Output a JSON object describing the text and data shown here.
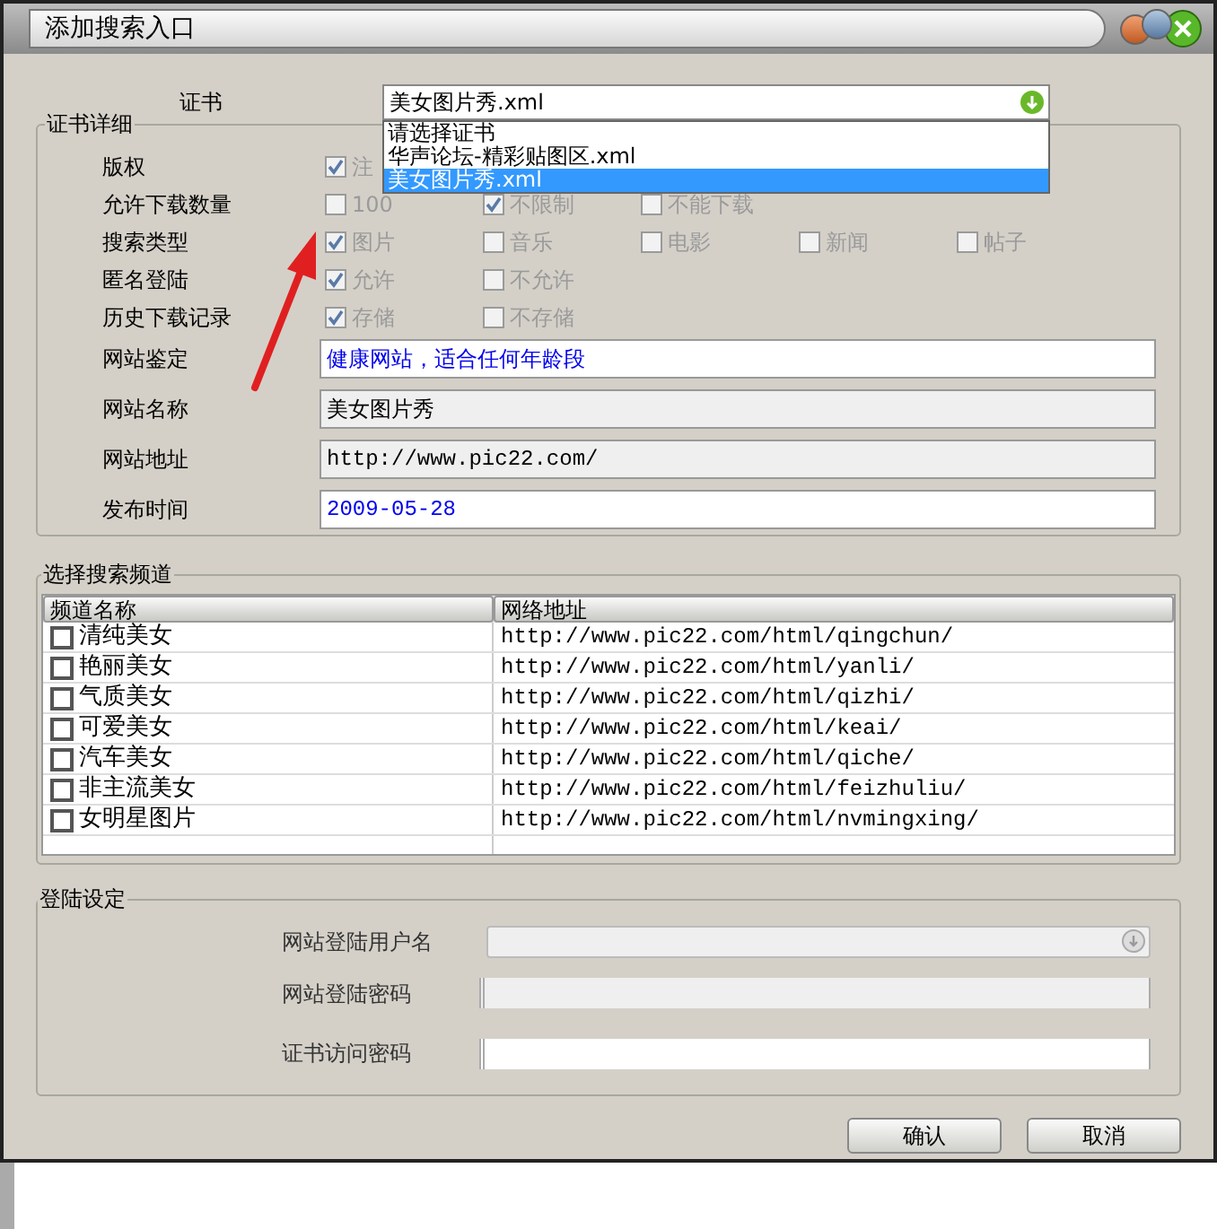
{
  "window": {
    "title": "添加搜索入口"
  },
  "certificate": {
    "label": "证书",
    "value": "美女图片秀.xml",
    "options": [
      {
        "label": "请选择证书",
        "selected": false
      },
      {
        "label": "华声论坛-精彩贴图区.xml",
        "selected": false
      },
      {
        "label": "美女图片秀.xml",
        "selected": true
      }
    ]
  },
  "details": {
    "title": "证书详细",
    "option_rows": [
      {
        "label": "版权",
        "options": [
          {
            "label": "注",
            "checked": true,
            "disabled": true
          }
        ]
      },
      {
        "label": "允许下载数量",
        "options": [
          {
            "label": "100",
            "checked": false,
            "disabled": true
          },
          {
            "label": "不限制",
            "checked": true,
            "disabled": true
          },
          {
            "label": "不能下载",
            "checked": false,
            "disabled": true
          }
        ]
      },
      {
        "label": "搜索类型",
        "options": [
          {
            "label": "图片",
            "checked": true,
            "disabled": true
          },
          {
            "label": "音乐",
            "checked": false,
            "disabled": true
          },
          {
            "label": "电影",
            "checked": false,
            "disabled": true
          },
          {
            "label": "新闻",
            "checked": false,
            "disabled": true
          },
          {
            "label": "帖子",
            "checked": false,
            "disabled": true
          }
        ]
      },
      {
        "label": "匿名登陆",
        "options": [
          {
            "label": "允许",
            "checked": true,
            "disabled": true
          },
          {
            "label": "不允许",
            "checked": false,
            "disabled": true
          }
        ]
      },
      {
        "label": "历史下载记录",
        "options": [
          {
            "label": "存储",
            "checked": true,
            "disabled": true
          },
          {
            "label": "不存储",
            "checked": false,
            "disabled": true
          }
        ]
      }
    ],
    "fields": [
      {
        "label": "网站鉴定",
        "value": "健康网站，适合任何年龄段",
        "readonly": false
      },
      {
        "label": "网站名称",
        "value": "美女图片秀",
        "readonly": true
      },
      {
        "label": "网站地址",
        "value": "http://www.pic22.com/",
        "readonly": true
      },
      {
        "label": "发布时间",
        "value": "2009-05-28",
        "readonly": false
      }
    ]
  },
  "channels": {
    "title": "选择搜索频道",
    "columns": [
      "频道名称",
      "网络地址"
    ],
    "rows": [
      {
        "name": "清纯美女",
        "url": "http://www.pic22.com/html/qingchun/",
        "checked": false
      },
      {
        "name": "艳丽美女",
        "url": "http://www.pic22.com/html/yanli/",
        "checked": false
      },
      {
        "name": "气质美女",
        "url": "http://www.pic22.com/html/qizhi/",
        "checked": false
      },
      {
        "name": "可爱美女",
        "url": "http://www.pic22.com/html/keai/",
        "checked": false
      },
      {
        "name": "汽车美女",
        "url": "http://www.pic22.com/html/qiche/",
        "checked": false
      },
      {
        "name": "非主流美女",
        "url": "http://www.pic22.com/html/feizhuliu/",
        "checked": false
      },
      {
        "name": "女明星图片",
        "url": "http://www.pic22.com/html/nvmingxing/",
        "checked": false
      }
    ]
  },
  "login": {
    "title": "登陆设定",
    "fields": [
      {
        "label": "网站登陆用户名",
        "kind": "dropdown",
        "disabled": true
      },
      {
        "label": "网站登陆密码",
        "kind": "password",
        "disabled": true
      },
      {
        "label": "证书访问密码",
        "kind": "password",
        "disabled": false
      }
    ]
  },
  "buttons": [
    "确认",
    "取消"
  ]
}
